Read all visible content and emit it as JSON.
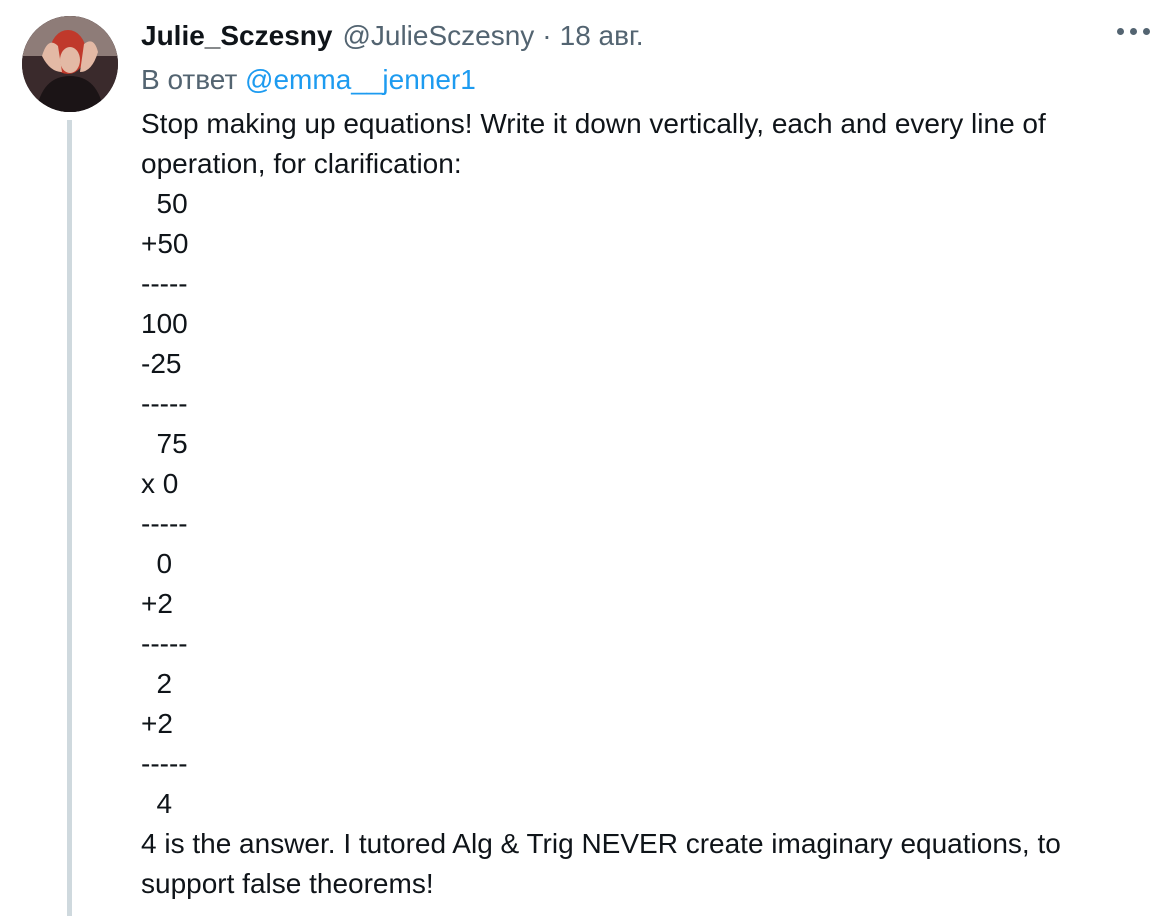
{
  "tweet": {
    "display_name": "Julie_Sczesny",
    "handle": "@JulieSczesny",
    "separator": "·",
    "date": "18 авг.",
    "reply_prefix": "В ответ",
    "reply_mention": "@emma__jenner1",
    "intro": "Stop making up equations! Write it down vertically, each and every line of operation, for clarification:",
    "calc_lines": [
      "  50",
      "+50",
      "-----",
      "100",
      "-25",
      "-----",
      "  75",
      "x 0",
      "-----",
      "  0",
      "+2",
      "-----",
      "  2",
      "+2",
      "-----",
      "  4"
    ],
    "outro": "4 is the answer. I tutored Alg & Trig NEVER create imaginary equations, to support false theorems!"
  },
  "icons": {
    "avatar": "profile-photo",
    "more": "more-dots-icon"
  },
  "colors": {
    "text": "#0f1419",
    "secondary": "#536471",
    "link": "#1d9bf0",
    "thread_line": "#cfd9de"
  }
}
